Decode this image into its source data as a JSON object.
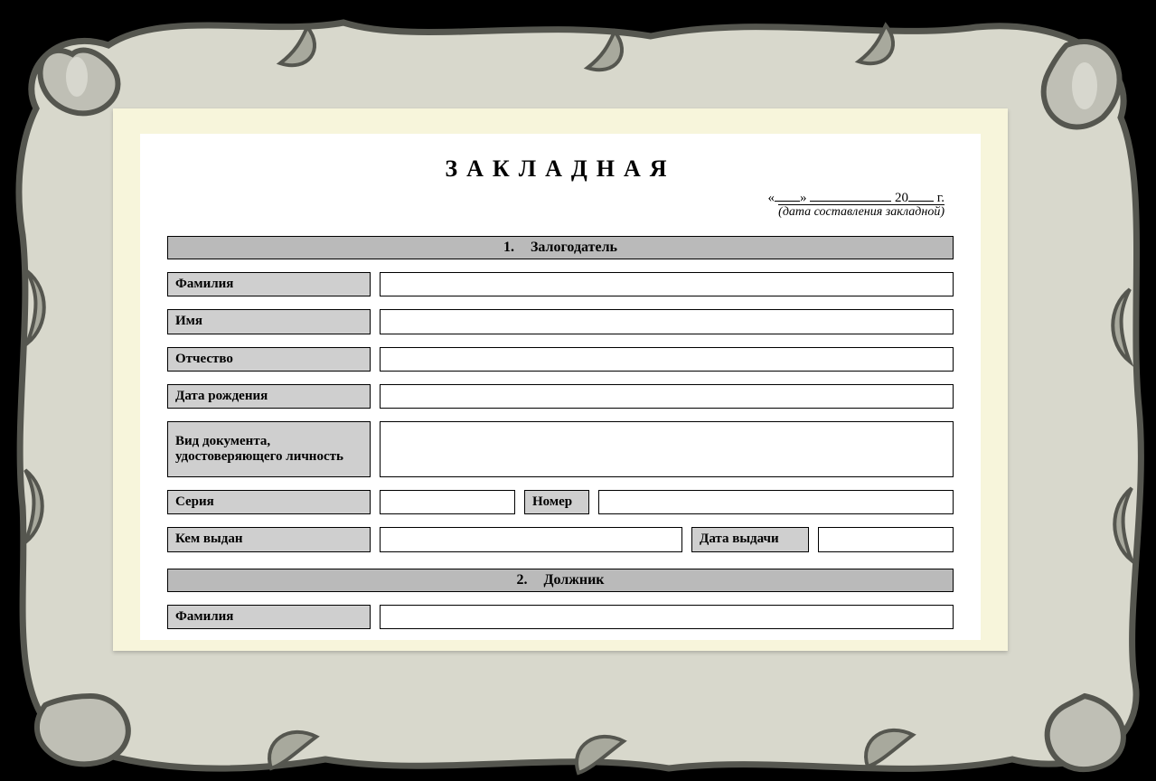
{
  "title": "ЗАКЛАДНАЯ",
  "date": {
    "open_quote": "«",
    "close_quote": "»",
    "century": "20",
    "year_suffix": "г.",
    "caption": "(дата составления закладной)"
  },
  "sections": {
    "s1": {
      "num": "1.",
      "title": "Залогодатель"
    },
    "s2": {
      "num": "2.",
      "title": "Должник"
    }
  },
  "labels": {
    "surname": "Фамилия",
    "name": "Имя",
    "patronymic": "Отчество",
    "birthdate": "Дата рождения",
    "doc_type": "Вид документа, удостоверяющего личность",
    "series": "Серия",
    "number": "Номер",
    "issued_by": "Кем выдан",
    "issue_date": "Дата выдачи"
  }
}
